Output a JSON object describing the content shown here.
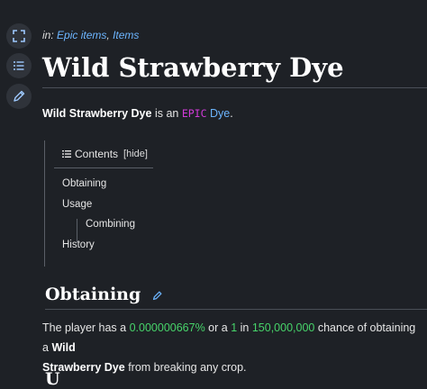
{
  "categories": {
    "prefix": "in:",
    "items": [
      "Epic items",
      "Items"
    ],
    "separator": ","
  },
  "title": "Wild Strawberry Dye",
  "intro": {
    "name": "Wild Strawberry Dye",
    "text1": " is an ",
    "rarity": "EPIC",
    "type_link": "Dye",
    "end": "."
  },
  "toc": {
    "heading": "Contents",
    "hide_label": "hide",
    "items": [
      "Obtaining",
      "Usage",
      "Combining",
      "History"
    ]
  },
  "section_obtaining": {
    "heading": "Obtaining",
    "t1": "The player has a ",
    "pct": "0.000000667%",
    "t2": " or a ",
    "one": "1",
    "t3": " in ",
    "odds": "150,000,000",
    "t4": " chance of obtaining a ",
    "bold1": "Wild",
    "bold2": "Strawberry Dye",
    "t5": " from breaking any crop."
  },
  "next_heading": "U",
  "colors": {
    "background": "#1e2126",
    "link": "#6cb5ff",
    "epic": "#d23ad8",
    "green": "#47d46a"
  },
  "icons": [
    "expand-icon",
    "list-icon",
    "pencil-icon",
    "edit-icon"
  ]
}
